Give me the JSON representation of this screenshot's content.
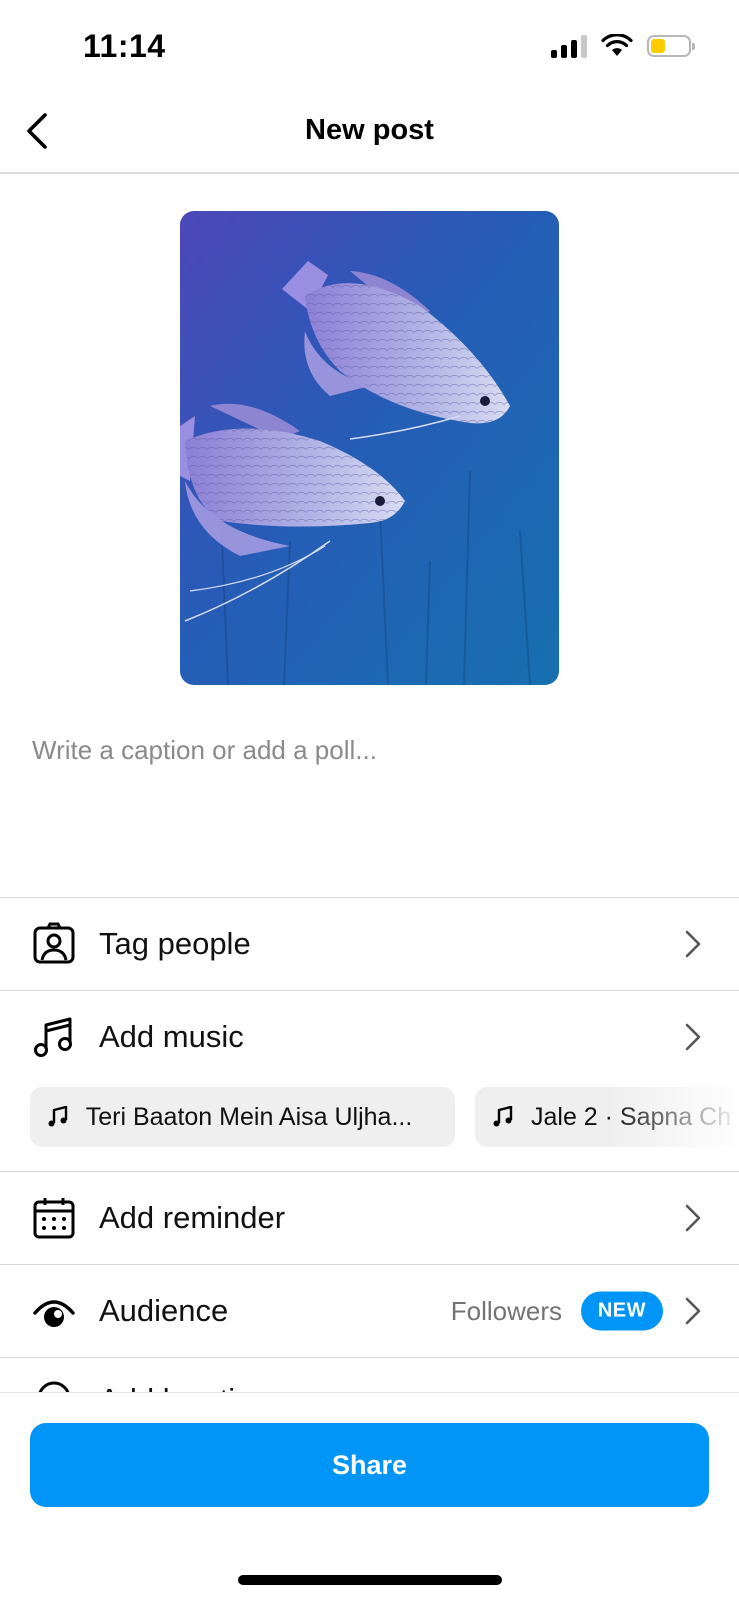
{
  "status_bar": {
    "time": "11:14",
    "battery_color": "#ffcc00"
  },
  "header": {
    "title": "New post",
    "back_icon": "chevron-left-icon"
  },
  "caption": {
    "placeholder": "Write a caption or add a poll..."
  },
  "menu": {
    "tag_people": {
      "label": "Tag people",
      "icon": "tag-person-icon"
    },
    "add_music": {
      "label": "Add music",
      "icon": "music-note-icon",
      "suggestions": [
        {
          "text": "Teri Baaton Mein Aisa Uljha..."
        },
        {
          "text": "Jale 2 · Sapna Ch"
        }
      ]
    },
    "add_reminder": {
      "label": "Add reminder",
      "icon": "calendar-icon"
    },
    "audience": {
      "label": "Audience",
      "value": "Followers",
      "badge": "NEW",
      "icon": "eye-icon"
    },
    "add_location": {
      "label": "Add location",
      "icon": "location-pin-icon"
    }
  },
  "footer": {
    "share_label": "Share",
    "accent_color": "#0095f6"
  }
}
